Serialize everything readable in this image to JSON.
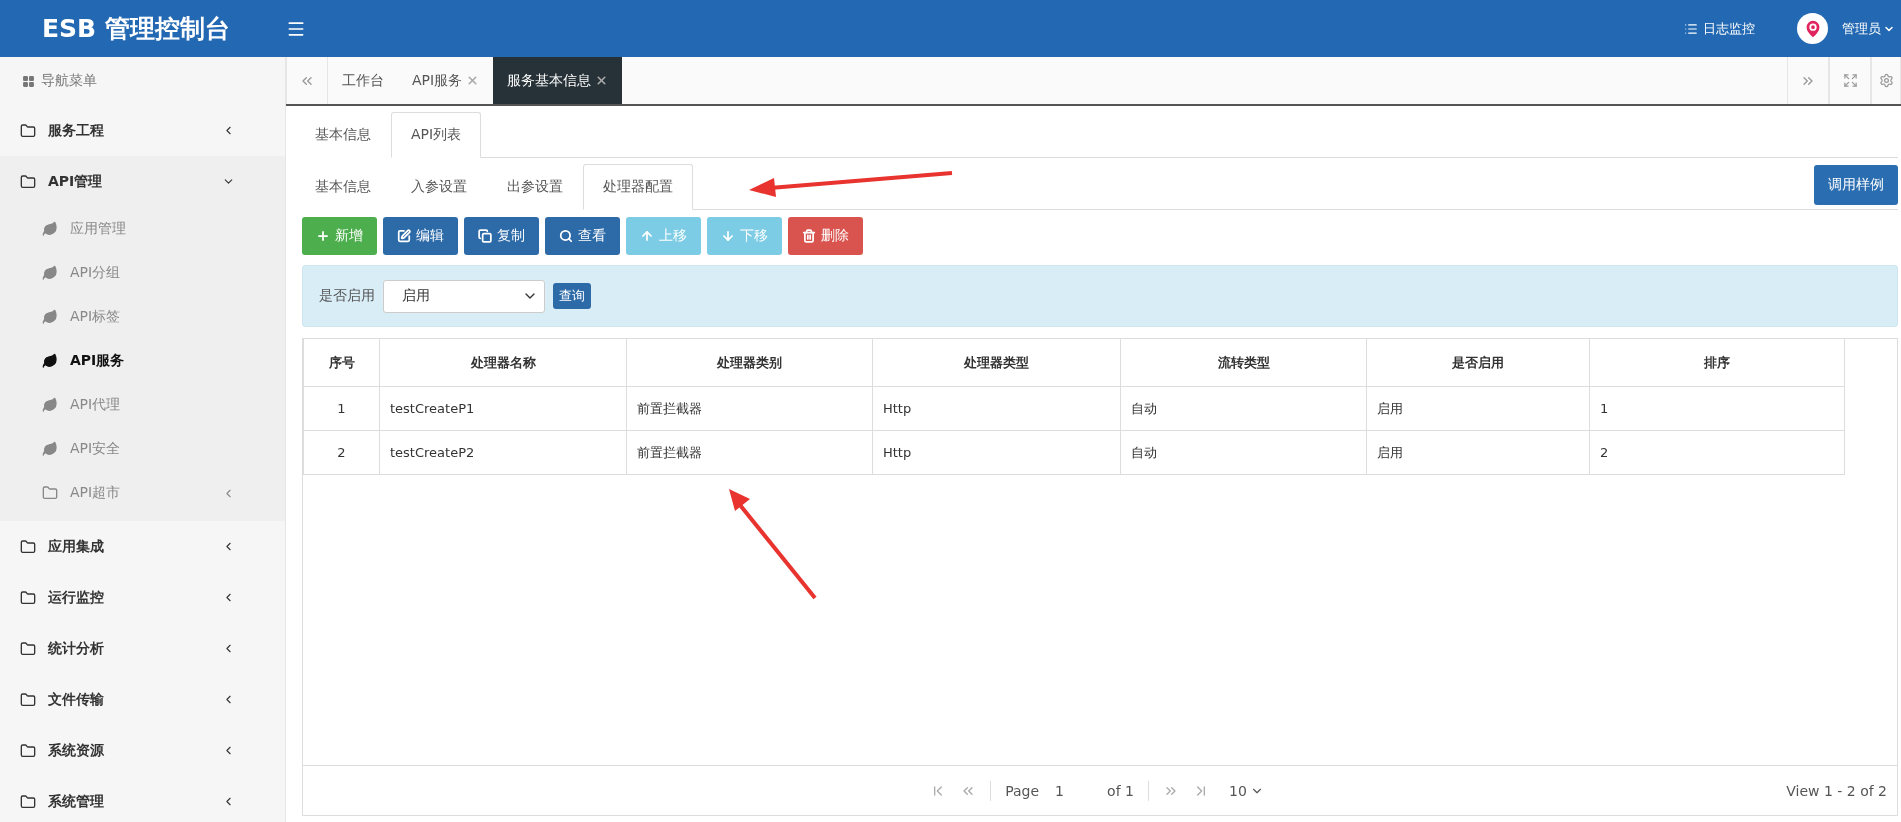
{
  "header": {
    "title": "ESB 管理控制台",
    "links": [
      {
        "label": "日志监控"
      }
    ],
    "user": {
      "name": "管理员"
    }
  },
  "sidebar": {
    "title": "导航菜单",
    "items": [
      {
        "label": "服务工程",
        "kind": "folder",
        "expanded": false,
        "selected": false
      },
      {
        "label": "API管理",
        "kind": "folder",
        "expanded": true,
        "selected": false,
        "children": [
          {
            "label": "应用管理",
            "kind": "leaf",
            "selected": false
          },
          {
            "label": "API分组",
            "kind": "leaf",
            "selected": false
          },
          {
            "label": "API标签",
            "kind": "leaf",
            "selected": false
          },
          {
            "label": "API服务",
            "kind": "leaf",
            "selected": true
          },
          {
            "label": "API代理",
            "kind": "leaf",
            "selected": false
          },
          {
            "label": "API安全",
            "kind": "leaf",
            "selected": false
          },
          {
            "label": "API超市",
            "kind": "folder",
            "expanded": false,
            "selected": false
          }
        ]
      },
      {
        "label": "应用集成",
        "kind": "folder",
        "expanded": false,
        "selected": false
      },
      {
        "label": "运行监控",
        "kind": "folder",
        "expanded": false,
        "selected": false
      },
      {
        "label": "统计分析",
        "kind": "folder",
        "expanded": false,
        "selected": false
      },
      {
        "label": "文件传输",
        "kind": "folder",
        "expanded": false,
        "selected": false
      },
      {
        "label": "系统资源",
        "kind": "folder",
        "expanded": false,
        "selected": false
      },
      {
        "label": "系统管理",
        "kind": "folder",
        "expanded": false,
        "selected": false
      }
    ]
  },
  "page_tabs": [
    {
      "label": "工作台",
      "selected": false,
      "closable": false
    },
    {
      "label": "API服务",
      "selected": false,
      "closable": true
    },
    {
      "label": "服务基本信息",
      "selected": true,
      "closable": true
    }
  ],
  "sub_tabs": [
    {
      "label": "基本信息",
      "selected": false
    },
    {
      "label": "API列表",
      "selected": true
    }
  ],
  "inner_tabs": [
    {
      "label": "基本信息",
      "selected": false
    },
    {
      "label": "入参设置",
      "selected": false
    },
    {
      "label": "出参设置",
      "selected": false
    },
    {
      "label": "处理器配置",
      "selected": true
    }
  ],
  "sample_button": "调用样例",
  "toolbar": [
    {
      "label": "新增",
      "kind": "add",
      "disabled": false
    },
    {
      "label": "编辑",
      "kind": "edit",
      "disabled": false
    },
    {
      "label": "复制",
      "kind": "copy",
      "disabled": false
    },
    {
      "label": "查看",
      "kind": "view",
      "disabled": false
    },
    {
      "label": "上移",
      "kind": "up",
      "disabled": true
    },
    {
      "label": "下移",
      "kind": "down",
      "disabled": true
    },
    {
      "label": "删除",
      "kind": "delete",
      "disabled": false
    }
  ],
  "filter": {
    "label": "是否启用",
    "value": "启用",
    "button": "查询"
  },
  "table": {
    "columns": [
      "序号",
      "处理器名称",
      "处理器类别",
      "处理器类型",
      "流转类型",
      "是否启用",
      "排序"
    ],
    "rows": [
      [
        "1",
        "testCreateP1",
        "前置拦截器",
        "Http",
        "自动",
        "启用",
        "1"
      ],
      [
        "2",
        "testCreateP2",
        "前置拦截器",
        "Http",
        "自动",
        "启用",
        "2"
      ]
    ]
  },
  "pager": {
    "page_label": "Page",
    "page": "1",
    "of": "of 1",
    "page_size": "10",
    "summary": "View 1 - 2 of 2"
  }
}
